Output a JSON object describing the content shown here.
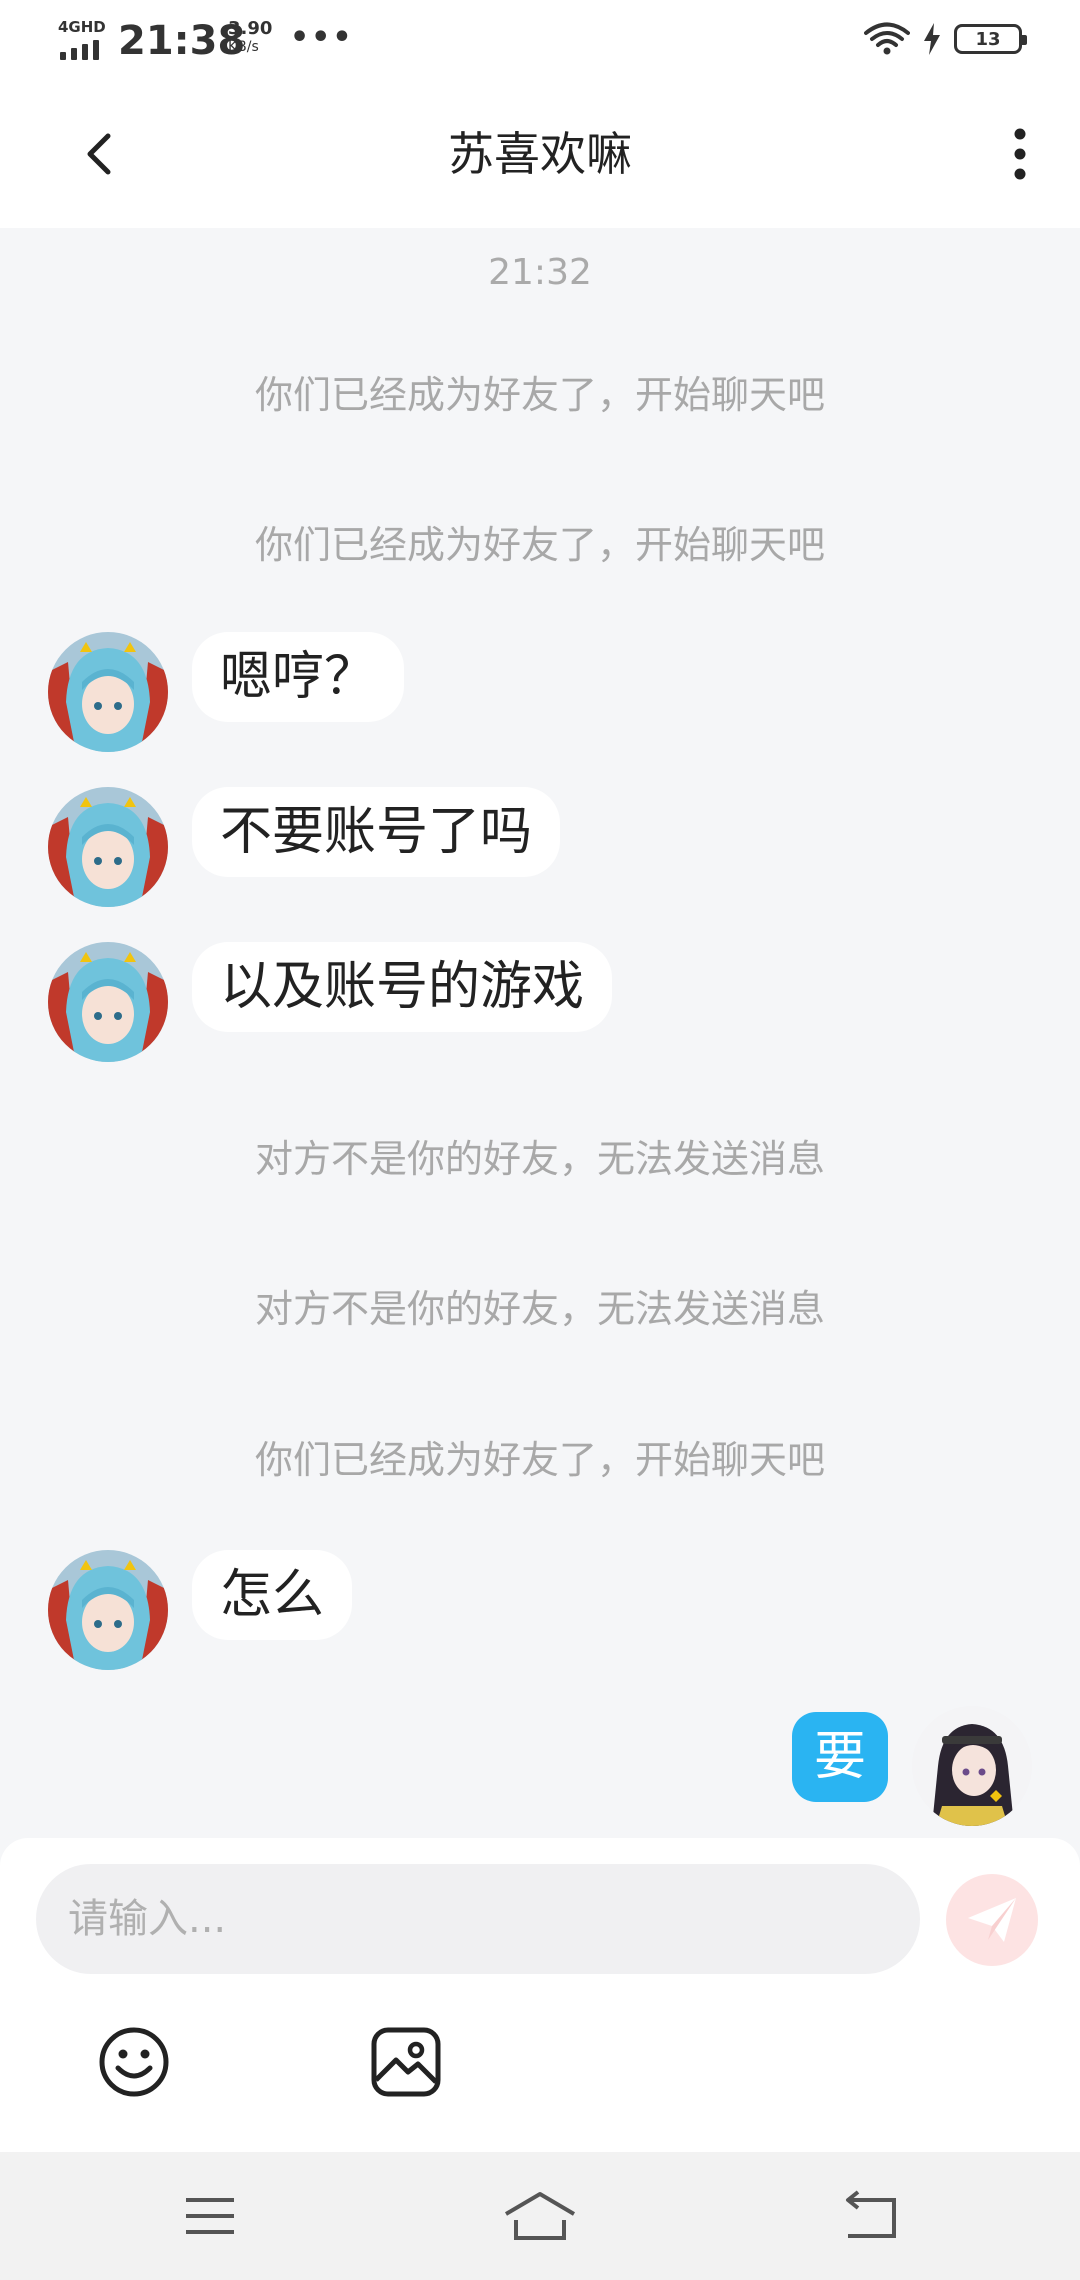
{
  "status_bar": {
    "network": "4GHD",
    "time": "21:38",
    "speed_value": "3.90",
    "speed_unit": "KB/s",
    "more": "•••",
    "battery": "13"
  },
  "header": {
    "title": "苏喜欢嘛",
    "back_icon": "chevron-left-icon",
    "menu_icon": "more-vertical-icon"
  },
  "chat": {
    "timestamp": "21:32",
    "system_messages": [
      "你们已经成为好友了，开始聊天吧",
      "你们已经成为好友了，开始聊天吧",
      "对方不是你的好友，无法发送消息",
      "对方不是你的好友，无法发送消息",
      "你们已经成为好友了，开始聊天吧"
    ],
    "messages": [
      {
        "sender": "other",
        "text": "嗯哼？"
      },
      {
        "sender": "other",
        "text": "不要账号了吗"
      },
      {
        "sender": "other",
        "text": "以及账号的游戏"
      },
      {
        "sender": "other",
        "text": "怎么"
      },
      {
        "sender": "me",
        "text": "要"
      }
    ]
  },
  "input": {
    "placeholder": "请输入...",
    "value": "",
    "send_icon": "send-icon",
    "tools": [
      "emoji-icon",
      "image-icon"
    ]
  },
  "nav_bar": {
    "icons": [
      "menu-icon",
      "home-icon",
      "back-icon"
    ]
  },
  "colors": {
    "accent": "#2ab4f2",
    "send_button": "#fde3e3",
    "background": "#f5f6f8",
    "system_text": "#a8a8a8"
  }
}
